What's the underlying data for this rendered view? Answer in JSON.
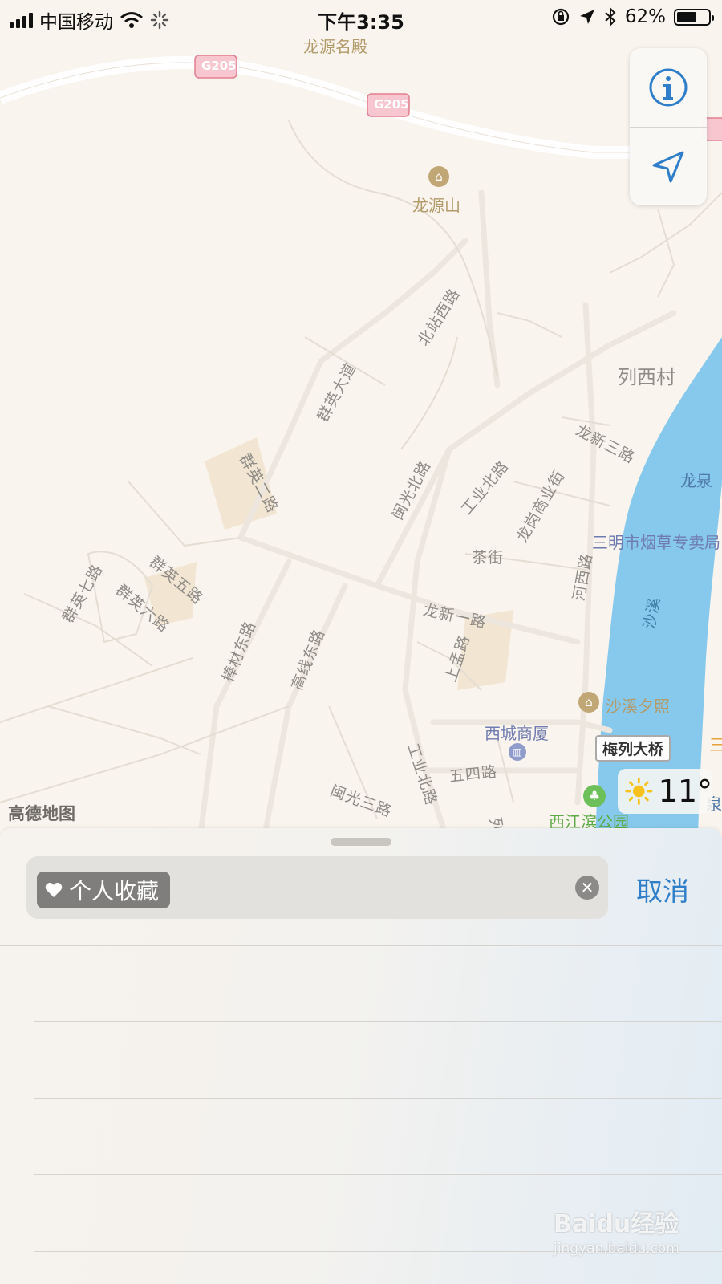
{
  "status_bar": {
    "carrier": "中国移动",
    "time": "下午3:35",
    "battery_percent": "62%",
    "battery_level": 0.62
  },
  "map": {
    "highway_shield": "G205",
    "poi_names": {
      "longyuan_mingdian": "龙源名殿",
      "longyuan_shan": "龙源山",
      "liexi_cun": "列西村",
      "longquan": "龙泉",
      "tobacco_store": "三明市烟草专卖局",
      "shaxi_xizhao": "沙溪夕照",
      "xicheng_shangsha": "西城商厦",
      "meilie_bridge": "梅列大桥",
      "xijiangbin_park": "西江滨公园",
      "quan": "泉",
      "san": "三"
    },
    "roads": {
      "beizhan_xilu": "北站西路",
      "qunying_dadao": "群英大道",
      "qunying_erlu": "群英二路",
      "qunying_wulu": "群英五路",
      "qunying_liulu": "群英六路",
      "qunying_qilu": "群英七路",
      "longxin_sanlu": "龙新三路",
      "minguang_beilu": "闽光北路",
      "gongye_beilu_1": "工业北路",
      "chajie": "茶街",
      "longgang_shangyejie": "龙岗商业街",
      "hexilu": "河西路",
      "longxin_yilu": "龙新一路",
      "shangmeng_lu": "上孟路",
      "bangcai_donglu": "棒材东路",
      "gaoxian_donglu": "高线东路",
      "gongye_beilu_2": "工业北路",
      "wusi_lu": "五四路",
      "minguang_sanlu": "闽光三路",
      "liexi": "列西",
      "river": "沙溪"
    },
    "attribution": "高德地图",
    "weather_temp": "11°"
  },
  "search_panel": {
    "token_label": "个人收藏",
    "cancel_label": "取消"
  },
  "watermark": {
    "brand": "Baidu经验",
    "url": "jingyan.baidu.com"
  },
  "colors": {
    "map_land": "#f9f4ed",
    "water": "#87c9ec",
    "accent_blue": "#2f7ec9",
    "poi_gold": "#b39a6a"
  },
  "icons": [
    "cellular-signal-icon",
    "wifi-icon",
    "activity-spinner-icon",
    "rotation-lock-icon",
    "location-arrow-icon",
    "bluetooth-icon",
    "battery-icon",
    "info-icon",
    "navigate-arrow-icon",
    "sun-icon",
    "heart-icon",
    "clear-icon",
    "landmark-icon",
    "park-tree-icon",
    "building-icon"
  ]
}
